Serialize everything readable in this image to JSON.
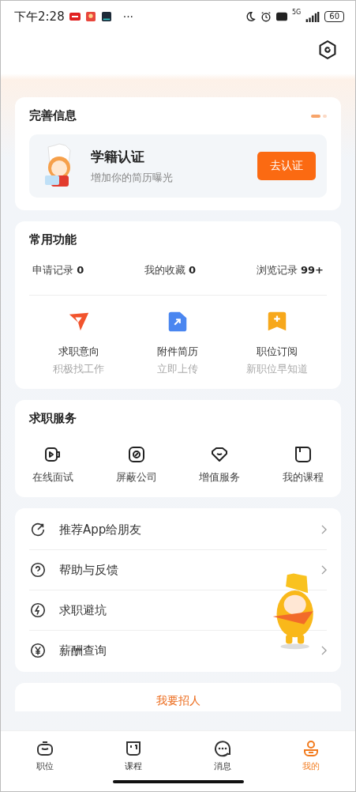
{
  "status_bar": {
    "time": "下午2:28",
    "more": "···",
    "network": "5G",
    "battery": "60"
  },
  "profile_info": {
    "title": "完善信息",
    "pages": [
      {
        "selected": true
      },
      {
        "selected": false
      }
    ],
    "card": {
      "title": "学籍认证",
      "subtitle": "增加你的简历曝光",
      "button": "去认证"
    }
  },
  "common_functions": {
    "title": "常用功能",
    "stats": [
      {
        "label": "申请记录",
        "count": "0"
      },
      {
        "label": "我的收藏",
        "count": "0"
      },
      {
        "label": "浏览记录",
        "count": "99+"
      }
    ],
    "shortcuts": [
      {
        "kind": "plane",
        "title": "求职意向",
        "subtitle": "积极找工作"
      },
      {
        "kind": "file",
        "title": "附件简历",
        "subtitle": "立即上传"
      },
      {
        "kind": "bookmark",
        "title": "职位订阅",
        "subtitle": "新职位早知道"
      }
    ]
  },
  "job_services": {
    "title": "求职服务",
    "items": [
      {
        "kind": "video",
        "label": "在线面试"
      },
      {
        "kind": "block",
        "label": "屏蔽公司"
      },
      {
        "kind": "heart",
        "label": "增值服务"
      },
      {
        "kind": "book",
        "label": "我的课程"
      }
    ]
  },
  "menu": [
    {
      "kind": "share",
      "label": "推荐App给朋友",
      "chevron": true
    },
    {
      "kind": "help",
      "label": "帮助与反馈",
      "chevron": true
    },
    {
      "kind": "bolt",
      "label": "求职避坑",
      "chevron": false
    },
    {
      "kind": "yuan",
      "label": "薪酬查询",
      "chevron": true
    }
  ],
  "recruit_banner": {
    "label": "我要招人"
  },
  "tab_bar": [
    {
      "kind": "bag",
      "label": "职位",
      "selected": false
    },
    {
      "kind": "course",
      "label": "课程",
      "selected": false
    },
    {
      "kind": "chat",
      "label": "消息",
      "selected": false
    },
    {
      "kind": "me",
      "label": "我的",
      "selected": true
    }
  ]
}
